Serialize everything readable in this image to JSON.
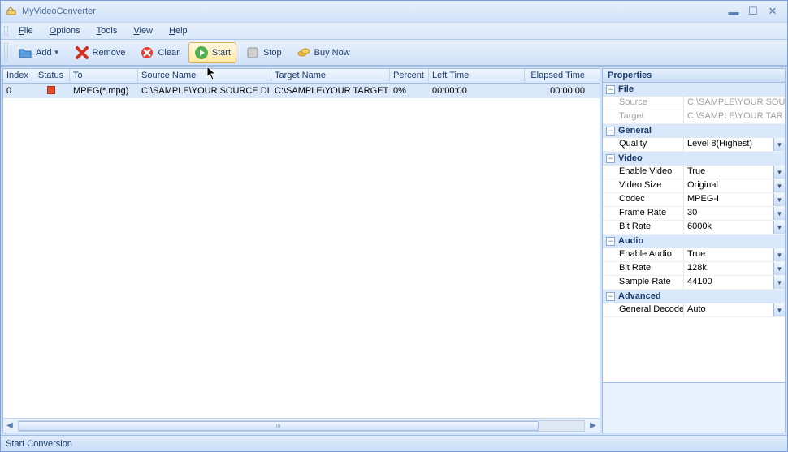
{
  "window": {
    "title": "MyVideoConverter"
  },
  "menu": {
    "file": "File",
    "options": "Options",
    "tools": "Tools",
    "view": "View",
    "help": "Help"
  },
  "toolbar": {
    "add": "Add",
    "remove": "Remove",
    "clear": "Clear",
    "start": "Start",
    "stop": "Stop",
    "buynow": "Buy Now"
  },
  "columns": {
    "index": "Index",
    "status": "Status",
    "to": "To",
    "source": "Source Name",
    "target": "Target Name",
    "percent": "Percent",
    "left": "Left Time",
    "elapsed": "Elapsed Time"
  },
  "rows": [
    {
      "index": "0",
      "to": "MPEG(*.mpg)",
      "source": "C:\\SAMPLE\\YOUR SOURCE DI...",
      "target": "C:\\SAMPLE\\YOUR TARGET ...",
      "percent": "0%",
      "left": "00:00:00",
      "elapsed": "00:00:00"
    }
  ],
  "properties": {
    "title": "Properties",
    "sections": {
      "file": {
        "label": "File",
        "source_k": "Source",
        "source_v": "C:\\SAMPLE\\YOUR SOU",
        "target_k": "Target",
        "target_v": "C:\\SAMPLE\\YOUR TAR"
      },
      "general": {
        "label": "General",
        "quality_k": "Quality",
        "quality_v": "Level 8(Highest)"
      },
      "video": {
        "label": "Video",
        "enable_k": "Enable Video",
        "enable_v": "True",
        "size_k": "Video Size",
        "size_v": "Original",
        "codec_k": "Codec",
        "codec_v": "MPEG-I",
        "fr_k": "Frame Rate",
        "fr_v": "30",
        "br_k": "Bit Rate",
        "br_v": "6000k"
      },
      "audio": {
        "label": "Audio",
        "enable_k": "Enable Audio",
        "enable_v": "True",
        "br_k": "Bit Rate",
        "br_v": "128k",
        "sr_k": "Sample Rate",
        "sr_v": "44100"
      },
      "advanced": {
        "label": "Advanced",
        "dec_k": "General Decoder",
        "dec_v": "Auto"
      }
    }
  },
  "statusbar": {
    "text": "Start Conversion"
  }
}
